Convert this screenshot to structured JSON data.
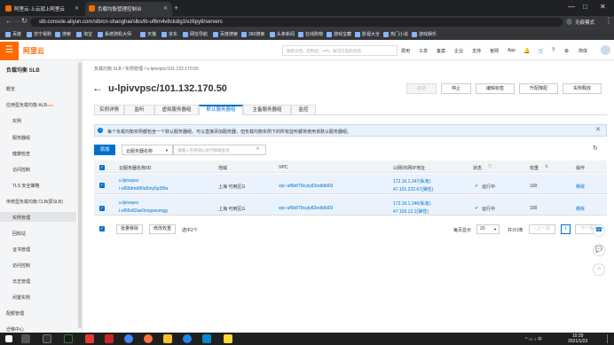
{
  "browser": {
    "tabs": [
      {
        "title": "阿里云-上云就上阿里云",
        "active": false
      },
      {
        "title": "负载均衡管理控制台",
        "active": true
      }
    ],
    "url": "slb.console.aliyun.com/slb/cn-shanghai/slbs/lb-uf6m4v8ckdig1lvz6py8/servers",
    "profile": "无痕模式",
    "bookmarks": [
      "百度",
      "苏宁易购",
      "搜索",
      "淘宝",
      "系统骑机大师",
      "天猫",
      "京东",
      "网址导航",
      "百度搜索",
      "360搜索",
      "头条新闻",
      "在线购物",
      "游戏宝藏",
      "影视大全",
      "热门小说",
      "游戏娱乐"
    ]
  },
  "topnav": {
    "logo": "阿里云",
    "search_placeholder": "搜索文档、控制台、API、解决方案和资源",
    "links": [
      "费用",
      "工单",
      "备案",
      "企业",
      "支持",
      "官网"
    ],
    "icons": [
      "App"
    ],
    "lang": "简体"
  },
  "sidebar": {
    "title": "负载均衡 SLB",
    "items": [
      {
        "label": "概览",
        "level": 0
      },
      {
        "label": "应用型负载均衡 ALB",
        "level": 0,
        "badge": "new"
      },
      {
        "label": "实例",
        "level": 1
      },
      {
        "label": "服务器组",
        "level": 1
      },
      {
        "label": "健康检查",
        "level": 1
      },
      {
        "label": "访问控制",
        "level": 1
      },
      {
        "label": "TLS 安全策略",
        "level": 1
      },
      {
        "label": "传统型负载均衡 CLB(原SLB)",
        "level": 0
      },
      {
        "label": "实例管理",
        "level": 1,
        "selected": true
      },
      {
        "label": "回收站",
        "level": 1
      },
      {
        "label": "证书管理",
        "level": 1
      },
      {
        "label": "访问控制",
        "level": 1
      },
      {
        "label": "日志管理",
        "level": 1
      },
      {
        "label": "闲置实例",
        "level": 1
      },
      {
        "label": "配额管理",
        "level": 0
      },
      {
        "label": "迁移中心",
        "level": 0
      }
    ]
  },
  "page": {
    "breadcrumb": "负载均衡 SLB  /  实例管理  /  u-lpivvpsc/101.132.170.50",
    "title": "u-lpivvpsc/101.132.170.50",
    "actions": [
      {
        "label": "启动",
        "disabled": true
      },
      {
        "label": "停止",
        "disabled": false
      },
      {
        "label": "编辑标签",
        "disabled": false
      },
      {
        "label": "升配降配",
        "disabled": false
      },
      {
        "label": "实例释放",
        "disabled": false
      }
    ],
    "tabs": [
      "实例详情",
      "监听",
      "虚拟服务器组",
      "默认服务器组",
      "主备服务器组",
      "监控"
    ],
    "active_tab": "默认服务器组",
    "info": "每个负载均衡实例都包含一个默认服务器组，可以直接添加服务器，但负载均衡实例下的所有监听都将使用该默认服务器组。",
    "toolbar": {
      "add": "添加",
      "filter_field": "云服务器名称",
      "filter_placeholder": "请输入名称或ID进行精确查询"
    },
    "table": {
      "columns": [
        "云服务器名称/ID",
        "地域",
        "VPC",
        "公网/内网IP地址",
        "状态",
        "权重",
        "操作"
      ],
      "rows": [
        {
          "name": "u-lpivvpsc",
          "id": "i-uf69dmb80a5my5p35fa",
          "region": "上海 可用区G",
          "vpc": "vpc-uf6b879cuty82edk8d03",
          "ip_public": "172.16.1.247(私有)",
          "ip_private": "47.101.222.67(弹性)",
          "status": "运行中",
          "weight": "100",
          "action": "移除"
        },
        {
          "name": "u-lpivvpsc",
          "id": "i-uf69v82ae0ovgxeumgg",
          "region": "上海 可用区G",
          "vpc": "vpc-uf6b879cuty82edk8d03",
          "ip_public": "172.16.1.246(私有)",
          "ip_private": "47.103.12.1(弹性)",
          "status": "运行中",
          "weight": "100",
          "action": "移除"
        }
      ]
    },
    "footer": {
      "batch_remove": "批量移除",
      "edit_weight": "修改权重",
      "selected": "选中2个",
      "page_size_label": "每页显示",
      "page_size": "20",
      "total": "共计2条",
      "prev": "上一页",
      "page": "1",
      "next": "下一页"
    }
  },
  "taskbar": {
    "time": "10:39",
    "date": "2021/1/23"
  }
}
